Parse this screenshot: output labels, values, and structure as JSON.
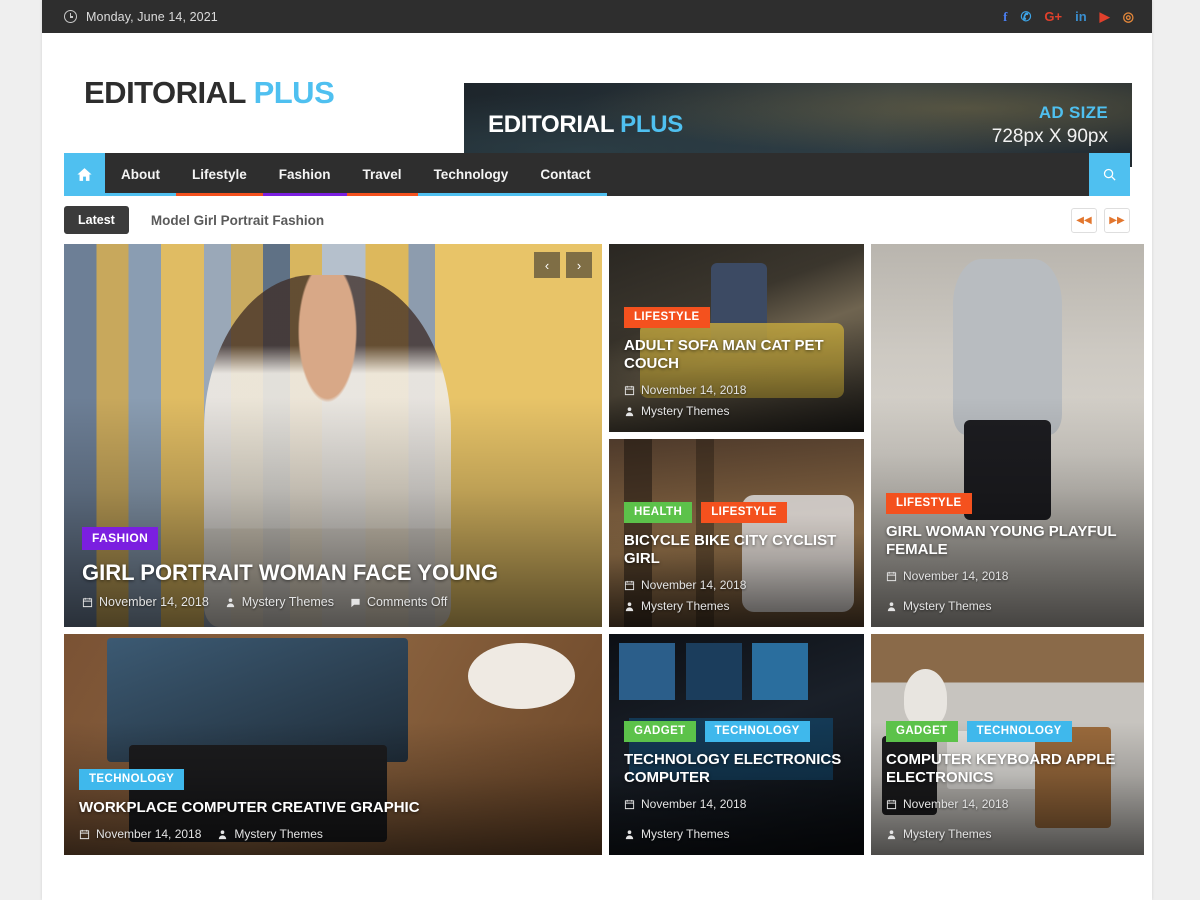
{
  "topbar": {
    "date": "Monday, June 14, 2021",
    "socials": [
      {
        "name": "facebook-icon",
        "glyph": "f",
        "color": "#4a7ef0"
      },
      {
        "name": "twitter-icon",
        "glyph": "✆",
        "color": "#3da5e8"
      },
      {
        "name": "google-plus-icon",
        "glyph": "G+",
        "color": "#e0402c"
      },
      {
        "name": "linkedin-icon",
        "glyph": "in",
        "color": "#3a8fd0"
      },
      {
        "name": "youtube-icon",
        "glyph": "▶",
        "color": "#e0402c"
      },
      {
        "name": "instagram-icon",
        "glyph": "◎",
        "color": "#e3873a"
      }
    ]
  },
  "masthead": {
    "logo_main": "EDITORIAL",
    "logo_accent": "PLUS",
    "ad": {
      "logo_main": "EDITORIAL",
      "logo_accent": "PLUS",
      "size_label": "AD SIZE",
      "size_dim": "728px X 90px"
    }
  },
  "nav": {
    "home_icon": "home-icon",
    "search_icon": "search-icon",
    "items": [
      {
        "label": "About",
        "underline": "#4fc0f0"
      },
      {
        "label": "Lifestyle",
        "underline": "#f4511e"
      },
      {
        "label": "Fashion",
        "underline": "#7b1fe0"
      },
      {
        "label": "Travel",
        "underline": "#f4511e"
      },
      {
        "label": "Technology",
        "underline": "#4fc0f0"
      },
      {
        "label": "Contact",
        "underline": "#4fc0f0"
      }
    ]
  },
  "latest": {
    "badge": "Latest",
    "headline": "Model Girl Portrait Fashion",
    "prev": "◀◀",
    "next": "▶▶"
  },
  "colors": {
    "accent_blue": "#4fc0f0",
    "cat_fashion": "#7b1fe0",
    "cat_lifestyle": "#f4511e",
    "cat_health": "#5cc24a",
    "cat_technology": "#3fb8ec",
    "cat_gadget": "#5cc24a",
    "dark": "#2e2e2e"
  },
  "slider": {
    "prev": "‹",
    "next": "›"
  },
  "posts": {
    "feature": {
      "title": "Girl Portrait Woman Face Young",
      "cats": [
        {
          "label": "FASHION",
          "color": "#7b1fe0"
        }
      ],
      "date": "November 14, 2018",
      "author": "Mystery Themes",
      "comments": "Comments Off"
    },
    "mid_top": {
      "title": "Adult Sofa Man Cat Pet Couch",
      "cats": [
        {
          "label": "LIFESTYLE",
          "color": "#f4511e"
        }
      ],
      "date": "November 14, 2018",
      "author": "Mystery Themes"
    },
    "mid_bottom": {
      "title": "Bicycle Bike City Cyclist Girl",
      "cats": [
        {
          "label": "HEALTH",
          "color": "#5cc24a"
        },
        {
          "label": "LIFESTYLE",
          "color": "#f4511e"
        }
      ],
      "date": "November 14, 2018",
      "author": "Mystery Themes"
    },
    "side": {
      "title": "Girl Woman Young Playful Female",
      "cats": [
        {
          "label": "LIFESTYLE",
          "color": "#f4511e"
        }
      ],
      "date": "November 14, 2018",
      "author": "Mystery Themes"
    },
    "bottom_1": {
      "title": "Workplace Computer Creative Graphic",
      "cats": [
        {
          "label": "TECHNOLOGY",
          "color": "#3fb8ec"
        }
      ],
      "date": "November 14, 2018",
      "author": "Mystery Themes"
    },
    "bottom_2": {
      "title": "Technology Electronics Computer",
      "cats": [
        {
          "label": "GADGET",
          "color": "#5cc24a"
        },
        {
          "label": "TECHNOLOGY",
          "color": "#3fb8ec"
        }
      ],
      "date": "November 14, 2018",
      "author": "Mystery Themes"
    },
    "bottom_3": {
      "title": "Computer Keyboard Apple Electronics",
      "cats": [
        {
          "label": "GADGET",
          "color": "#5cc24a"
        },
        {
          "label": "TECHNOLOGY",
          "color": "#3fb8ec"
        }
      ],
      "date": "November 14, 2018",
      "author": "Mystery Themes"
    }
  }
}
